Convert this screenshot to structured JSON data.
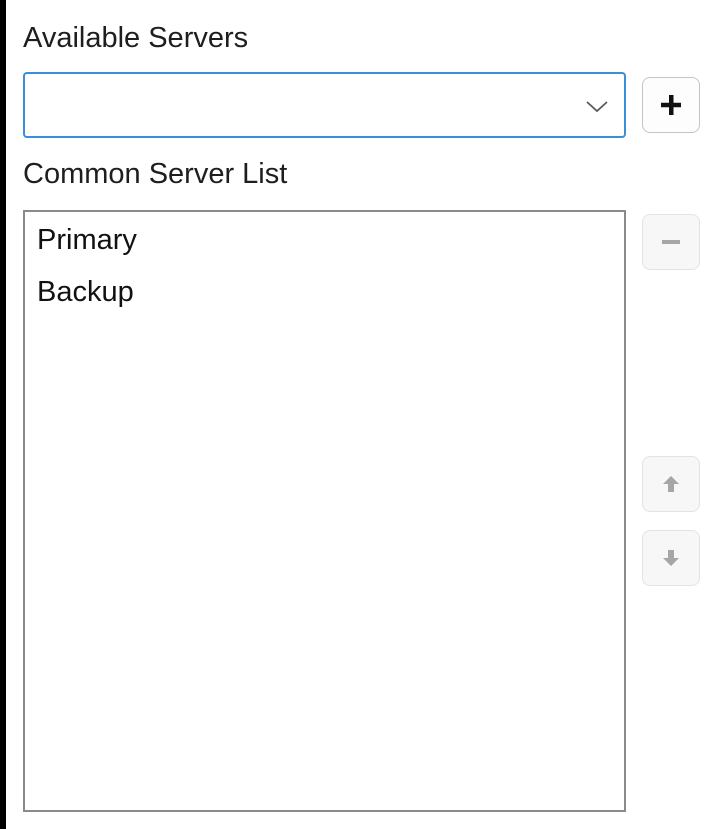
{
  "available_servers": {
    "label": "Available Servers",
    "combo_value": "",
    "add_button_icon": "plus-icon"
  },
  "common_servers": {
    "label": "Common Server List",
    "items": [
      {
        "label": "Primary"
      },
      {
        "label": "Backup"
      }
    ],
    "remove_button_icon": "minus-icon",
    "move_up_button_icon": "arrow-up-icon",
    "move_down_button_icon": "arrow-down-icon"
  },
  "colors": {
    "focus_border": "#3b8fd9",
    "text": "#1e1e1e",
    "disabled_glyph": "#a6a6a6"
  }
}
